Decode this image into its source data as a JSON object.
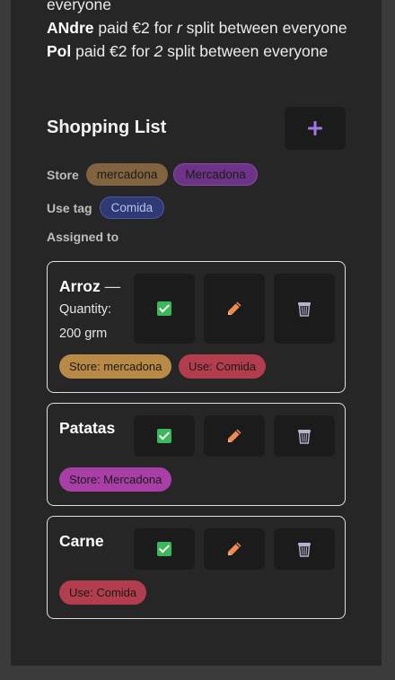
{
  "expenses": [
    {
      "name": "",
      "text": "everyone"
    },
    {
      "name": "ANdre",
      "pre": " paid €2 for ",
      "item": "r",
      "post": " split between everyone"
    },
    {
      "name": "Pol",
      "pre": " paid €2 for ",
      "item": "2",
      "post": " split between everyone"
    }
  ],
  "shopping": {
    "title": "Shopping List",
    "add_label": "+",
    "store_label": "Store",
    "stores": [
      "mercadona",
      "Mercadona"
    ],
    "use_tag_label": "Use tag",
    "use_tags": [
      "Comida"
    ],
    "assigned_label": "Assigned to"
  },
  "items": [
    {
      "name": "Arroz",
      "dash": " —",
      "quantity_line1": "Quantity:",
      "quantity_line2": "200 grm",
      "tags": [
        "Store: mercadona",
        "Use: Comida"
      ]
    },
    {
      "name": "Patatas",
      "tags": [
        "Store: Mercadona"
      ]
    },
    {
      "name": "Carne",
      "tags": [
        "Use: Comida"
      ]
    }
  ],
  "colors": {
    "check": "#3bb85a",
    "pencil": "#f08a50",
    "trash": "#b7b2d1",
    "plus": "#9e7be0"
  }
}
